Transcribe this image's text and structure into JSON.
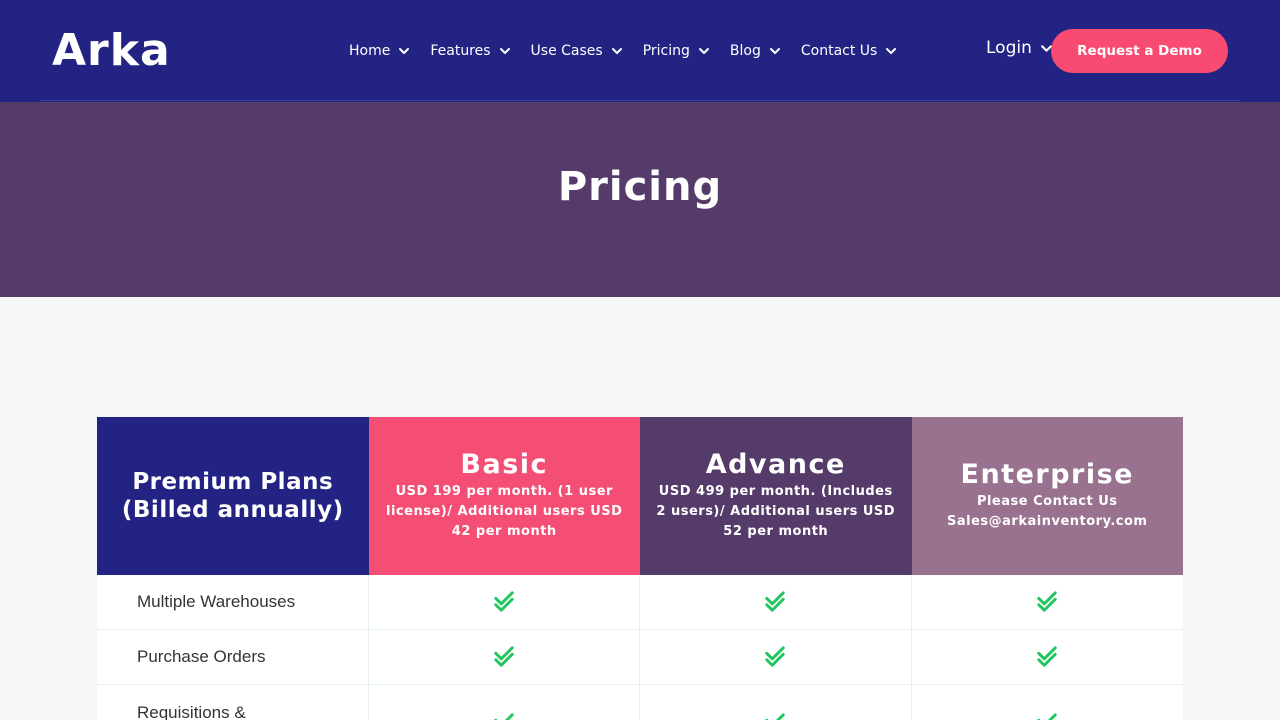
{
  "header": {
    "logo": "Arka",
    "nav": [
      {
        "label": "Home"
      },
      {
        "label": "Features"
      },
      {
        "label": "Use Cases"
      },
      {
        "label": "Pricing"
      },
      {
        "label": "Blog"
      },
      {
        "label": "Contact Us"
      }
    ],
    "login_label": "Login",
    "demo_label": "Request a Demo"
  },
  "banner": {
    "title": "Pricing"
  },
  "pricing_table": {
    "columns": [
      {
        "name": "Premium Plans (Billed annually)",
        "desc": ""
      },
      {
        "name": "Basic",
        "desc": "USD 199 per month. (1 user license)/ Additional users USD 42 per month"
      },
      {
        "name": "Advance",
        "desc": "USD 499 per month. (Includes 2 users)/ Additional users USD 52 per month"
      },
      {
        "name": "Enterprise",
        "desc": "Please Contact Us Sales@arkainventory.com"
      }
    ],
    "rows": [
      {
        "feature": "Multiple Warehouses",
        "basic": true,
        "advance": true,
        "enterprise": true
      },
      {
        "feature": "Purchase Orders",
        "basic": true,
        "advance": true,
        "enterprise": true
      },
      {
        "feature": "Requisitions &",
        "basic": true,
        "advance": true,
        "enterprise": true
      }
    ]
  },
  "colors": {
    "header_bg": "#232383",
    "banner_bg": "#553b69",
    "accent": "#f94a71",
    "basic_bg": "#f44e74",
    "advance_bg": "#553b69",
    "enterprise_bg": "#99728f",
    "check": "#22c55e"
  }
}
